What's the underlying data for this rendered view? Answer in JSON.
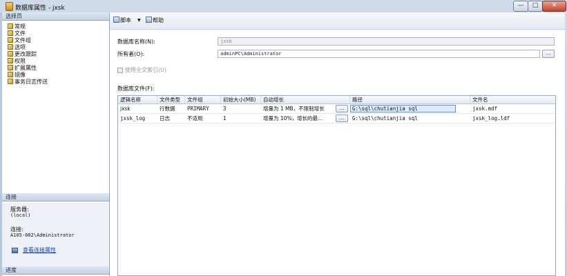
{
  "window": {
    "title": "数据库属性 - jxsk",
    "btn_min": "—",
    "btn_max": "□",
    "btn_close": "✕"
  },
  "left": {
    "select_page_header": "选择页",
    "pages": [
      "常规",
      "文件",
      "文件组",
      "选项",
      "更改跟踪",
      "权限",
      "扩展属性",
      "镜像",
      "事务日志传送"
    ],
    "connection_header": "连接",
    "server_label": "服务器:",
    "server_value": "(local)",
    "connection_label": "连接:",
    "connection_value": "A105-002\\Administrator",
    "view_conn_link": "查看连接属性",
    "progress_header": "进度"
  },
  "toolbar": {
    "script_label": "脚本",
    "help_label": "帮助"
  },
  "form": {
    "dbname_label": "数据库名称(N):",
    "dbname_value": "jxsk",
    "owner_label": "所有者(O):",
    "owner_value": "adminPC\\Administrator",
    "owner_browse": "...",
    "fulltext_label": "使用全文索引(U)",
    "files_label": "数据库文件(F):"
  },
  "grid": {
    "columns": [
      "逻辑名称",
      "文件类型",
      "文件组",
      "初始大小(MB)",
      "自动增长",
      "路径",
      "文件名"
    ],
    "rows": [
      {
        "logical": "jxsk",
        "type": "行数据",
        "group": "PRIMARY",
        "size": "3",
        "growth": "增量为 1 MB，不限制增长",
        "browse": "...",
        "path": "G:\\sql\\chutianjia sql",
        "file": "jxsk.mdf"
      },
      {
        "logical": "jxsk_log",
        "type": "日志",
        "group": "不适用",
        "size": "1",
        "growth": "增量为 10%，增长的最...",
        "browse": "...",
        "path": "G:\\sql\\chutianjia sql",
        "file": "jxsk_log.ldf"
      }
    ]
  }
}
